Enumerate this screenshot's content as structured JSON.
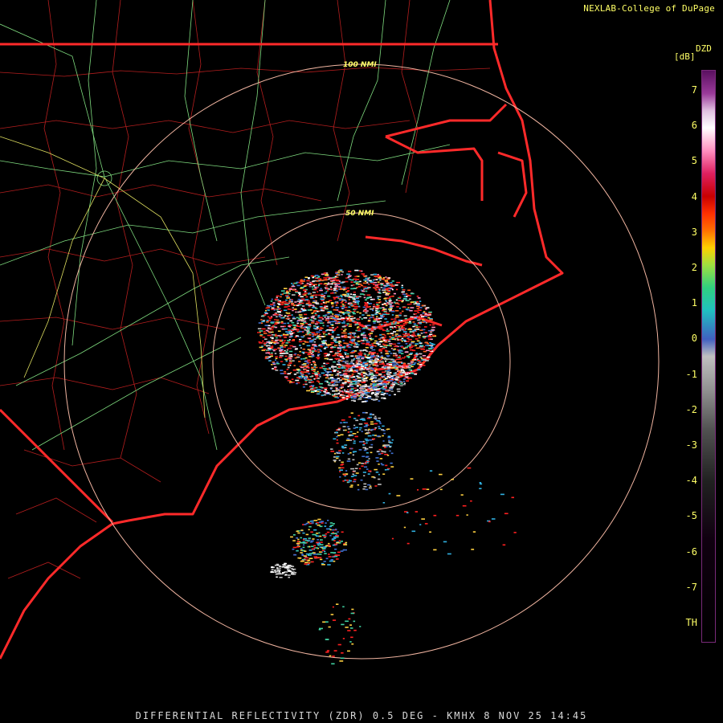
{
  "credit": "NEXLAB-College of DuPage",
  "footer": "DIFFERENTIAL REFLECTIVITY (ZDR) 0.5 DEG - KMHX 8 NOV 25 14:45",
  "legend": {
    "name": "DZD",
    "unit": "[dB]",
    "ticks": [
      "7",
      "6",
      "5",
      "4",
      "3",
      "2",
      "1",
      "0",
      "-1",
      "-2",
      "-3",
      "-4",
      "-5",
      "-6",
      "-7",
      "TH"
    ]
  },
  "range_rings": {
    "r100_label": "100 NMI",
    "r50_label": "50 NMI"
  },
  "colors": {
    "state_border": "#ff2a2a",
    "county_border": "#b41e1e",
    "highways": "#7fdc7f",
    "range_ring": "#f0b4a0",
    "labels": "#ffff66"
  }
}
